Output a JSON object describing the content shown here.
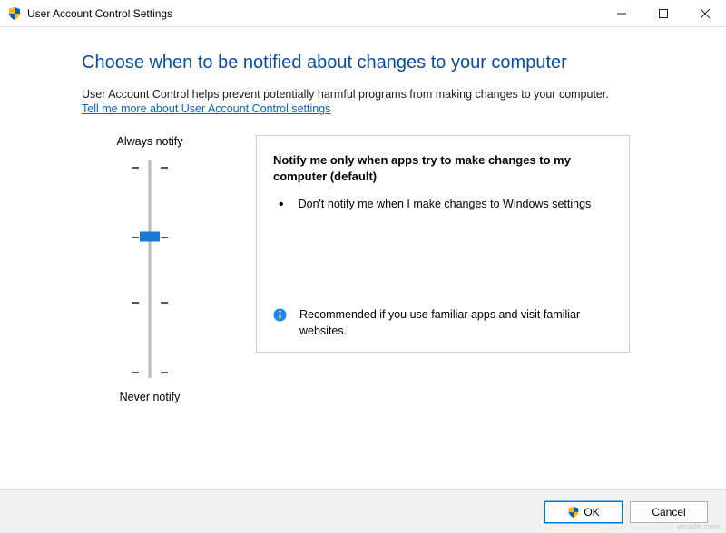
{
  "window": {
    "title": "User Account Control Settings"
  },
  "main": {
    "heading": "Choose when to be notified about changes to your computer",
    "description": "User Account Control helps prevent potentially harmful programs from making changes to your computer.",
    "link": "Tell me more about User Account Control settings"
  },
  "slider": {
    "top_label": "Always notify",
    "bottom_label": "Never notify",
    "level_count": 4,
    "current_level": 2
  },
  "panel": {
    "title": "Notify me only when apps try to make changes to my computer (default)",
    "bullets": [
      "Don't notify me when I make changes to Windows settings"
    ],
    "footer": "Recommended if you use familiar apps and visit familiar websites."
  },
  "buttons": {
    "ok": "OK",
    "cancel": "Cancel"
  },
  "watermark": "wsxdn.com"
}
